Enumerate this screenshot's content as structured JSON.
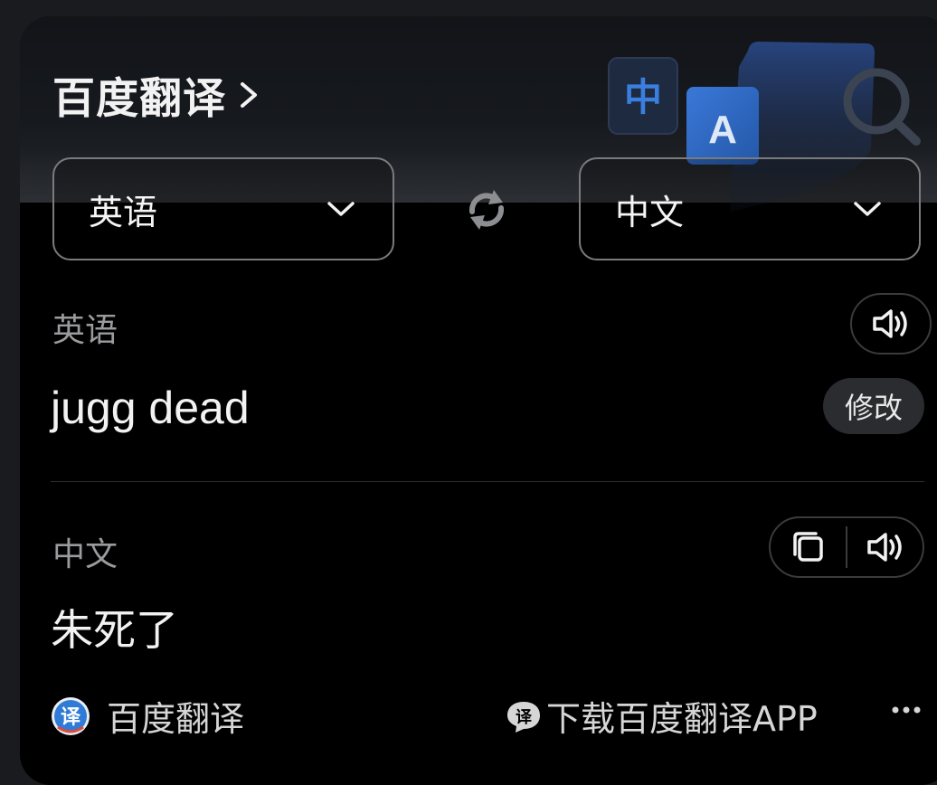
{
  "header": {
    "title": "百度翻译",
    "deco_zh_glyph": "中",
    "deco_en_glyph": "A"
  },
  "languages": {
    "source": "英语",
    "target": "中文"
  },
  "source_panel": {
    "label": "英语",
    "text": "jugg dead",
    "modify_label": "修改"
  },
  "target_panel": {
    "label": "中文",
    "text": "朱死了"
  },
  "footer": {
    "brand_label": "百度翻译",
    "brand_logo_glyph": "译",
    "download_glyph": "译",
    "download_label": "下载百度翻译APP"
  },
  "colors": {
    "background": "#000000",
    "accent_blue": "#2f7bd6",
    "text_primary": "#f2f2f2",
    "text_secondary": "#9a9b9e"
  }
}
